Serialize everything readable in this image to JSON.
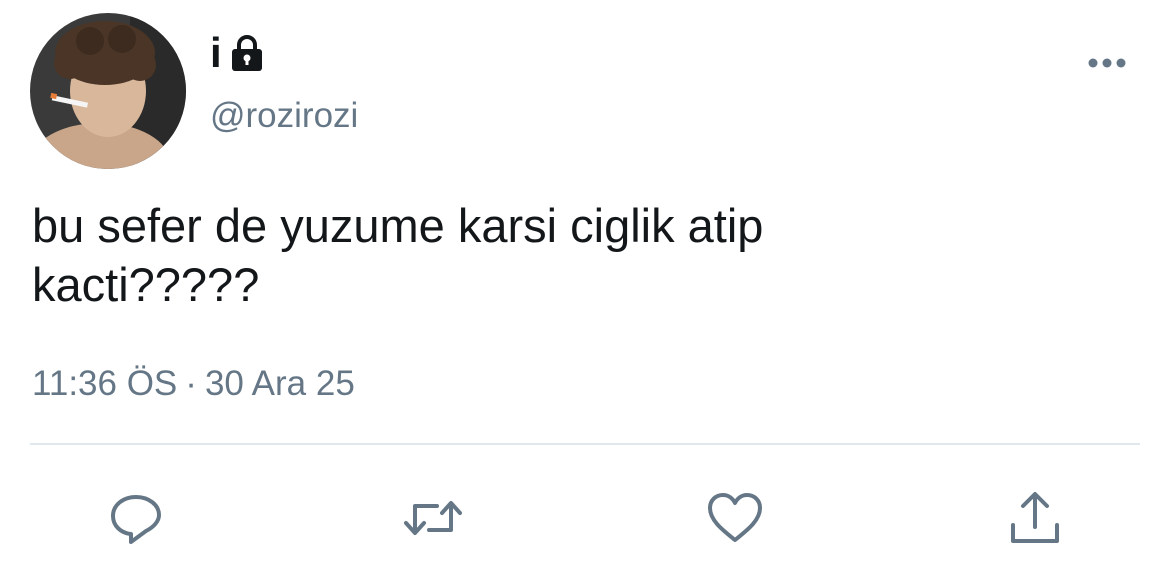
{
  "user": {
    "display_name": "i",
    "handle": "@rozirozi",
    "protected_icon": "lock-icon",
    "avatar_icon": "avatar-photo"
  },
  "tweet": {
    "text": "bu sefer de yuzume karsi ciglik atip\nkacti?????",
    "time": "11:36 ÖS",
    "separator": "·",
    "date": "30 Ara 25"
  },
  "actions": {
    "reply_icon": "reply-icon",
    "retweet_icon": "retweet-icon",
    "like_icon": "heart-icon",
    "share_icon": "share-icon",
    "more_icon": "more-dots-icon"
  },
  "colors": {
    "text": "#14171a",
    "secondary": "#657786",
    "divider": "#e1e8ed"
  }
}
